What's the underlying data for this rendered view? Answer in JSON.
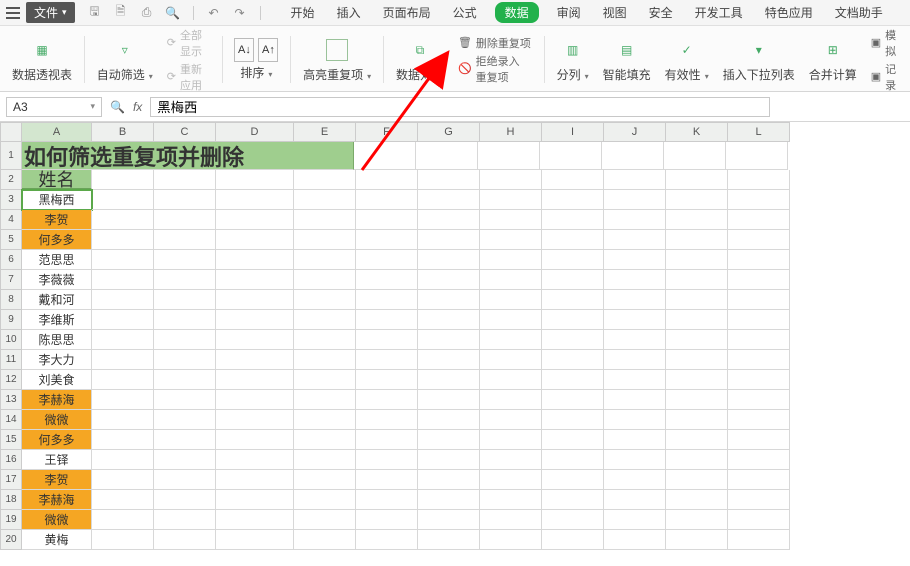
{
  "titlebar": {
    "file_label": "文件"
  },
  "tabs": {
    "items": [
      "开始",
      "插入",
      "页面布局",
      "公式",
      "数据",
      "审阅",
      "视图",
      "安全",
      "开发工具",
      "特色应用",
      "文档助手"
    ],
    "active_index": 4
  },
  "ribbon": {
    "pivot": "数据透视表",
    "autofilter": "自动筛选",
    "showall": "全部显示",
    "reapply": "重新应用",
    "sort": "排序",
    "highlight_dup": "高亮重复项",
    "data_compare": "数据对比",
    "remove_dup": "删除重复项",
    "reject_dup": "拒绝录入重复项",
    "text_to_cols": "分列",
    "smart_fill": "智能填充",
    "validation": "有效性",
    "dropdown": "插入下拉列表",
    "consolidate": "合并计算",
    "simulate": "模拟",
    "record": "记录"
  },
  "formula_bar": {
    "name_box": "A3",
    "formula": "黑梅西"
  },
  "columns": [
    "A",
    "B",
    "C",
    "D",
    "E",
    "F",
    "G",
    "H",
    "I",
    "J",
    "K",
    "L"
  ],
  "title_text": "如何筛选重复项并删除",
  "header_text": "姓名",
  "rows": [
    {
      "n": 3,
      "v": "黑梅西",
      "dup": false,
      "sel": true
    },
    {
      "n": 4,
      "v": "李贺",
      "dup": true
    },
    {
      "n": 5,
      "v": "何多多",
      "dup": true
    },
    {
      "n": 6,
      "v": "范思思",
      "dup": false
    },
    {
      "n": 7,
      "v": "李薇薇",
      "dup": false
    },
    {
      "n": 8,
      "v": "戴和河",
      "dup": false
    },
    {
      "n": 9,
      "v": "李维斯",
      "dup": false
    },
    {
      "n": 10,
      "v": "陈思思",
      "dup": false
    },
    {
      "n": 11,
      "v": "李大力",
      "dup": false
    },
    {
      "n": 12,
      "v": "刘美食",
      "dup": false
    },
    {
      "n": 13,
      "v": "李赫海",
      "dup": true
    },
    {
      "n": 14,
      "v": "微微",
      "dup": true
    },
    {
      "n": 15,
      "v": "何多多",
      "dup": true
    },
    {
      "n": 16,
      "v": "王铎",
      "dup": false
    },
    {
      "n": 17,
      "v": "李贺",
      "dup": true
    },
    {
      "n": 18,
      "v": "李赫海",
      "dup": true
    },
    {
      "n": 19,
      "v": "微微",
      "dup": true
    },
    {
      "n": 20,
      "v": "黄梅",
      "dup": false
    }
  ]
}
